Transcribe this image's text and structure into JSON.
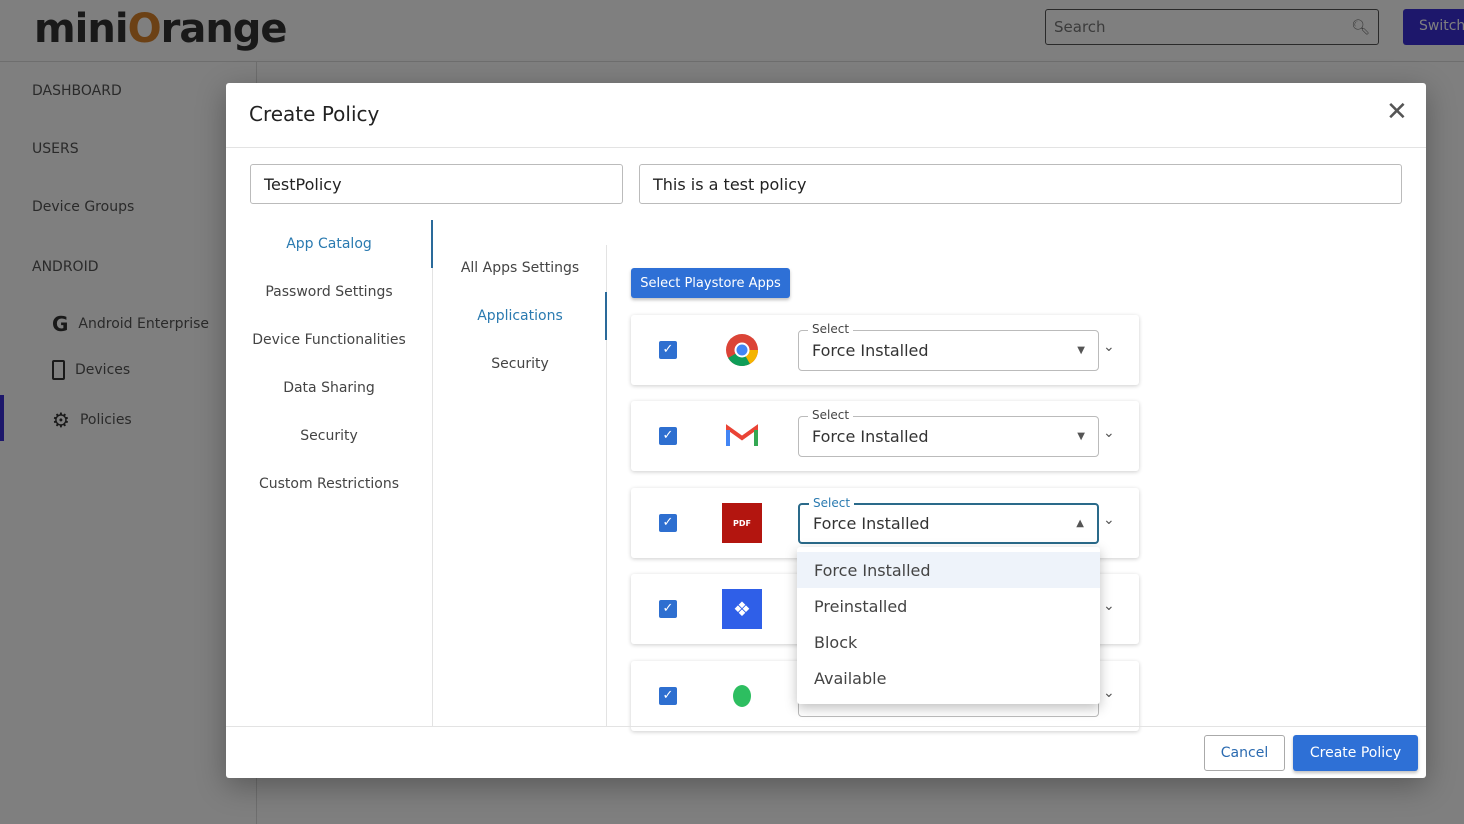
{
  "brand": {
    "logo_text": "miniOrange"
  },
  "header": {
    "search_placeholder": "Search",
    "switch_label": "Switch"
  },
  "sidebar": {
    "items": [
      "DASHBOARD",
      "USERS",
      "Device Groups",
      "ANDROID"
    ],
    "android_items": [
      "Android Enterprise",
      "Devices",
      "Policies"
    ],
    "active": "Policies"
  },
  "modal": {
    "title": "Create Policy",
    "name_value": "TestPolicy",
    "description_value": "This is a test policy",
    "nav": [
      "App Catalog",
      "Password Settings",
      "Device Functionalities",
      "Data Sharing",
      "Security",
      "Custom Restrictions"
    ],
    "nav_active": "App Catalog",
    "subnav": [
      "All Apps Settings",
      "Applications",
      "Security"
    ],
    "subnav_active": "Applications",
    "playstore_button": "Select Playstore Apps",
    "select_label": "Select",
    "apps": [
      {
        "icon": "chrome-icon",
        "value": "Force Installed",
        "checked": true
      },
      {
        "icon": "gmail-icon",
        "value": "Force Installed",
        "checked": true
      },
      {
        "icon": "adobe-pdf-icon",
        "value": "Force Installed",
        "checked": true,
        "open": true
      },
      {
        "icon": "dropbox-icon",
        "value": "",
        "checked": true
      },
      {
        "icon": "evernote-icon",
        "value": "",
        "checked": true
      }
    ],
    "dropdown_options": [
      "Force Installed",
      "Preinstalled",
      "Block",
      "Available"
    ],
    "dropdown_highlighted": "Force Installed",
    "cancel_label": "Cancel",
    "create_label": "Create Policy"
  },
  "colors": {
    "accent": "#2e70d6",
    "brand_purple": "#3b2fd6",
    "logo_orange": "#d9822b"
  }
}
